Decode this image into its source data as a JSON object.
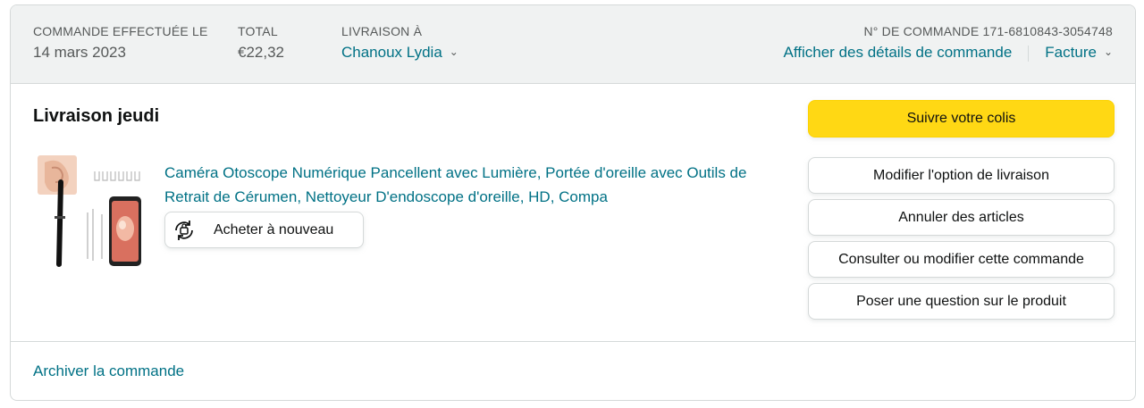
{
  "header": {
    "order_placed_label": "COMMANDE EFFECTUÉE LE",
    "order_placed_value": "14 mars 2023",
    "total_label": "TOTAL",
    "total_value": "€22,32",
    "ship_to_label": "LIVRAISON À",
    "ship_to_value": "Chanoux Lydia",
    "order_number_label": "N° DE COMMANDE 171-6810843-3054748",
    "order_details_link": "Afficher des détails de commande",
    "invoice_link": "Facture"
  },
  "shipment": {
    "status_title": "Livraison jeudi",
    "product_title": "Caméra Otoscope Numérique Pancellent avec Lumière, Portée d'oreille avec Outils de Retrait de Cérumen, Nettoyeur D'endoscope d'oreille, HD, Compa",
    "buy_again_label": "Acheter à nouveau"
  },
  "actions": {
    "track": "Suivre votre colis",
    "change_delivery": "Modifier l'option de livraison",
    "cancel_items": "Annuler des articles",
    "view_edit_order": "Consulter ou modifier cette commande",
    "ask_question": "Poser une question sur le produit"
  },
  "footer": {
    "archive_link": "Archiver la commande"
  },
  "colors": {
    "link": "#007185",
    "primary_button": "#ffd814",
    "header_bg": "#f0f2f2",
    "border": "#d5d9d9"
  },
  "icons": {
    "buy_again": "reorder-cycle-icon",
    "dropdown": "chevron-down-icon"
  }
}
